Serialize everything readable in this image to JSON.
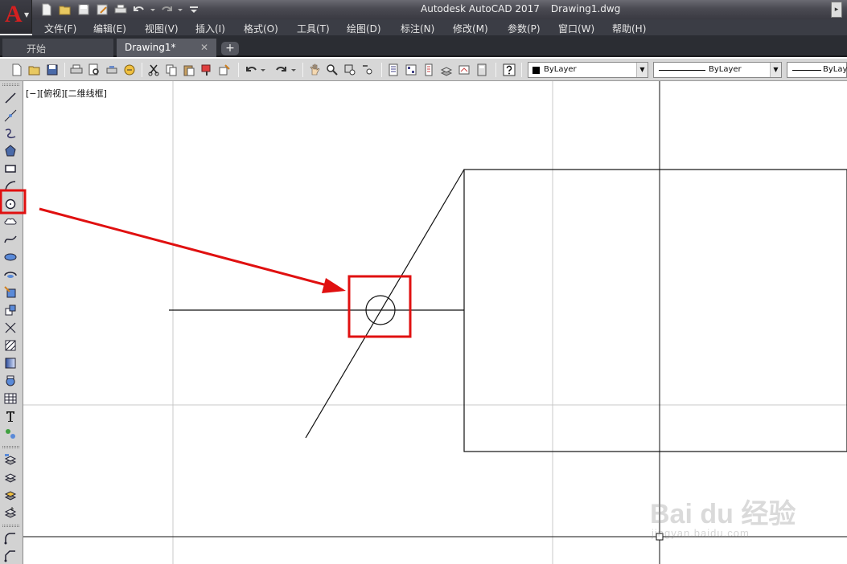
{
  "title_bar": {
    "app_name": "Autodesk AutoCAD 2017",
    "document": "Drawing1.dwg",
    "logo_letter": "A"
  },
  "quick_access": [
    "new-icon",
    "open-icon",
    "save-icon",
    "save-as-icon",
    "plot-icon",
    "undo-icon",
    "redo-icon",
    "customize-icon"
  ],
  "menu": {
    "items": [
      "文件(F)",
      "编辑(E)",
      "视图(V)",
      "插入(I)",
      "格式(O)",
      "工具(T)",
      "绘图(D)",
      "标注(N)",
      "修改(M)",
      "参数(P)",
      "窗口(W)",
      "帮助(H)"
    ]
  },
  "tabs": {
    "start": "开始",
    "drawing": "Drawing1*",
    "close_glyph": "✕",
    "add_glyph": "+"
  },
  "properties": {
    "layer": "ByLayer",
    "linetype": "ByLayer",
    "lineweight": "ByLayer"
  },
  "viewport": {
    "label": "[−][俯视][二维线框]"
  },
  "draw_tools": [
    "line-icon",
    "construction-line-icon",
    "polyline-icon",
    "polygon-icon",
    "rectangle-icon",
    "arc-icon",
    "circle-icon",
    "revision-cloud-icon",
    "spline-icon",
    "ellipse-icon",
    "ellipse-arc-icon",
    "insert-block-icon",
    "make-block-icon",
    "point-icon",
    "hatch-icon",
    "gradient-icon",
    "region-icon",
    "table-icon",
    "multiline-text-icon",
    "add-selected-icon"
  ],
  "watermark": {
    "brand": "Bai du 经验",
    "url": "jingyan.baidu.com"
  },
  "colors": {
    "annotation": "#e01010",
    "titlebar": "#4a4a52",
    "menubar": "#3b3d45",
    "toolbar": "#d7d7d7"
  }
}
